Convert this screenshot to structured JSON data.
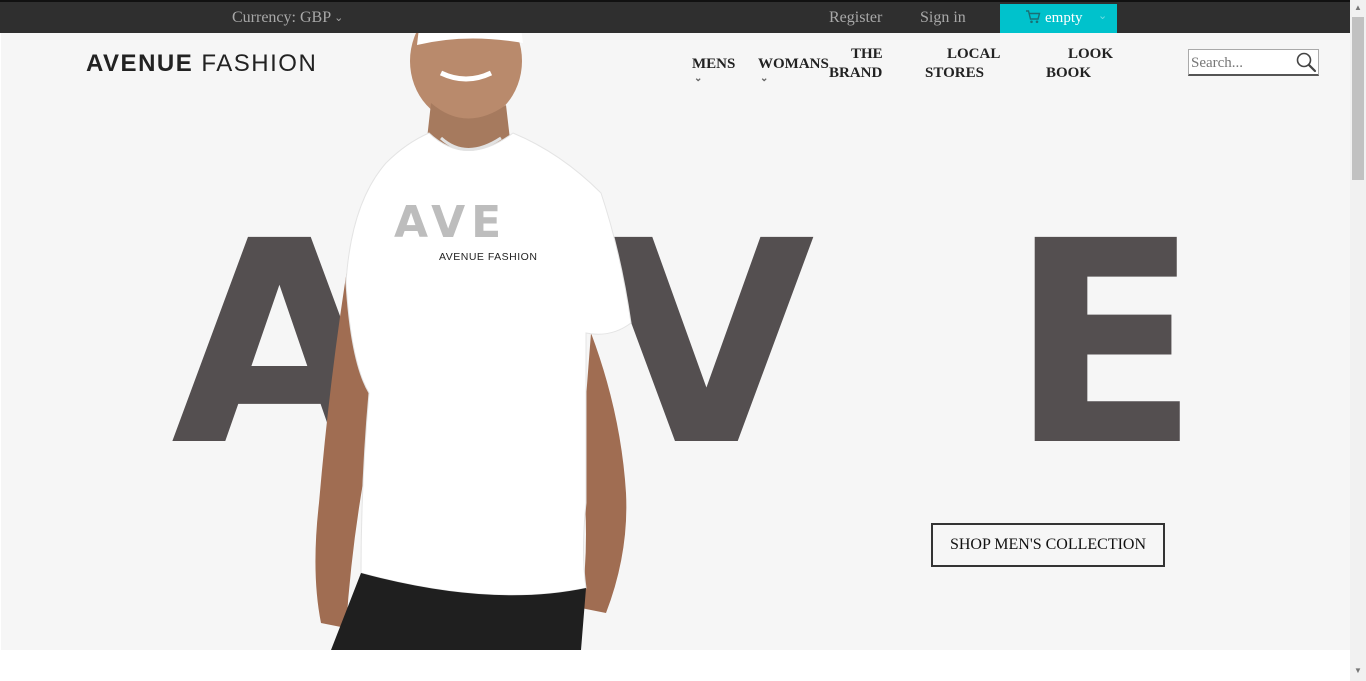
{
  "topbar": {
    "currency_label": "Currency: GBP",
    "register_label": "Register",
    "signin_label": "Sign in",
    "cart_label": "empty"
  },
  "header": {
    "logo_bold": "AVENUE",
    "logo_light": "FASHION",
    "nav": [
      {
        "line1": "MENS",
        "line2": "",
        "has_dropdown": true
      },
      {
        "line1": "WOMANS",
        "line2": "",
        "has_dropdown": true
      },
      {
        "line1": "THE",
        "line2": "BRAND",
        "has_dropdown": false
      },
      {
        "line1": "LOCAL",
        "line2": "STORES",
        "has_dropdown": false
      },
      {
        "line1": "LOOK",
        "line2": "BOOK",
        "has_dropdown": false
      }
    ],
    "search_placeholder": "Search..."
  },
  "hero": {
    "letters": [
      "A",
      "V",
      "E"
    ],
    "shirt_letters": "AVE",
    "shirt_print": "AVENUE FASHION",
    "cta_label": "SHOP MEN'S COLLECTION"
  },
  "colors": {
    "topbar_bg": "#2f2f2f",
    "cart_accent": "#00c2cc",
    "hero_bg": "#f6f6f6",
    "hero_letters": "#544f50"
  }
}
